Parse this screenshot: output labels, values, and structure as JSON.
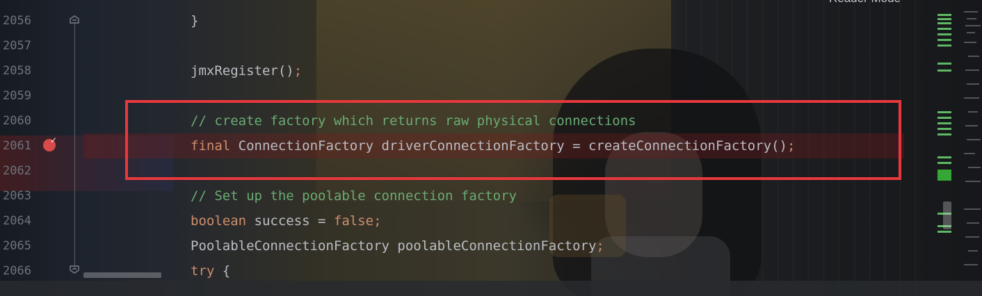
{
  "editor": {
    "reader_mode_label": "Reader Mode",
    "line_numbers": [
      "2056",
      "2057",
      "2058",
      "2059",
      "2060",
      "2061",
      "2062",
      "2063",
      "2064",
      "2065",
      "2066"
    ],
    "lines": [
      {
        "text": "}"
      },
      {
        "text": ""
      },
      {
        "text": "jmxRegister();"
      },
      {
        "text": ""
      },
      {
        "text": "// create factory which returns raw physical connections"
      },
      {
        "text": "final ConnectionFactory driverConnectionFactory = createConnectionFactory();"
      },
      {
        "text": ""
      },
      {
        "text": "// Set up the poolable connection factory"
      },
      {
        "text": "boolean success = false;"
      },
      {
        "text": "PoolableConnectionFactory poolableConnectionFactory;"
      },
      {
        "text": "try {"
      }
    ],
    "breakpoint_line": "2061",
    "highlight_color": "#e8383d"
  },
  "icons": {
    "breakpoint": "breakpoint-check-icon",
    "fold": "fold-icon",
    "reader_check": "check-icon"
  }
}
